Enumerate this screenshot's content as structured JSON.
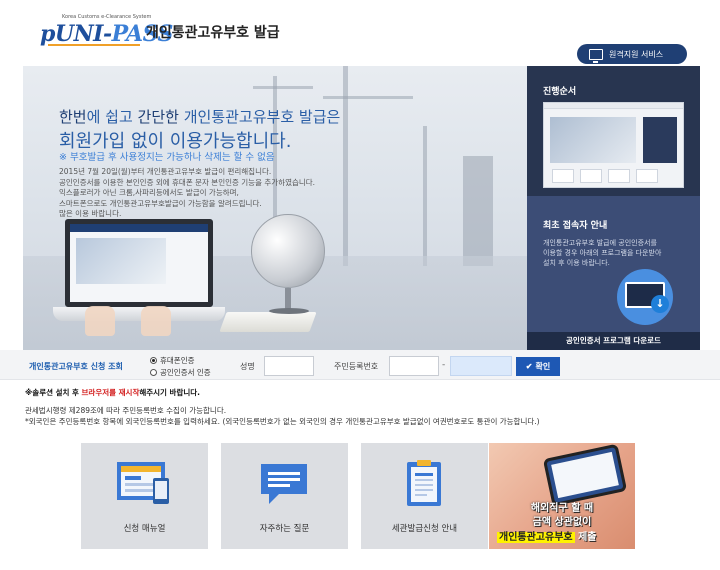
{
  "header": {
    "logo_tagline": "Korea Customs e-Clearance System",
    "logo_text_main": "UNI-",
    "logo_text_accent": "PASS",
    "logo_prefix": "p",
    "site_title": "개인통관고유부호 발급",
    "remote_service_label": "원격지원 서비스"
  },
  "banner": {
    "headline_part1": "한번",
    "headline_part2": "에 쉽고 ",
    "headline_part3": "간단한",
    "headline_part4": " 개인통관고유부호 발급은",
    "headline_line2": "회원가입 없이 이용가능합니다.",
    "note": "※ 부호발급 후 사용정지는 가능하나 삭제는 할 수 없음",
    "description": [
      "2015년 7월 20일(월)부터 개인통관고유부호 발급이 편리해집니다.",
      "공인인증서를 이용한 본인인증 외에 휴대폰 문자 본인인증 기능을 추가하였습니다.",
      "익스플로러가 아닌 크롬,사파리등에서도 발급이 가능하며,",
      "스마트폰으로도 개인통관고유부호발급이 가능함을 알려드립니다.",
      "많은 이용 바랍니다."
    ]
  },
  "right_panel": {
    "process_title": "진행순서",
    "first_visit_title": "최초 접속자 안내",
    "first_visit_desc": [
      "개인통관고유부호 발급에 공인인증서를",
      "이용할 경우 아래의 프로그램을 다운받아",
      "설치 후 이용 바랍니다."
    ],
    "download_label": "공인인증서 프로그램 다운로드"
  },
  "form": {
    "title": "개인통관고유부호 신청 조회",
    "radio_phone": "휴대폰인증",
    "radio_cert": "공인인증서 인증",
    "name_label": "성명",
    "name_value": "",
    "rrn_label": "주민등록번호",
    "rrn_front": "",
    "rrn_back": "",
    "rrn_separator": "-",
    "confirm_label": "확인"
  },
  "notices": {
    "line1_prefix": "※솔루션 설치 후 ",
    "line1_red": "브라우저를 재시작",
    "line1_suffix": "해주시기 바랍니다.",
    "line2": "관세법시행령 제289조에 따라 주민등록번호 수집이 가능합니다.",
    "line3": "*외국인은 주민등록번호 항목에 외국인등록번호를 입력하세요.   (외국인등록번호가 없는 외국인의 경우 개인통관고유부호 발급없이 여권번호로도 통관이 가능합니다.)"
  },
  "tiles": [
    {
      "label": "신청 매뉴얼",
      "icon": "manual-screen-icon"
    },
    {
      "label": "자주하는 질문",
      "icon": "chat-bubble-icon"
    },
    {
      "label": "세관발급신청 안내",
      "icon": "clipboard-document-icon"
    }
  ],
  "promo": {
    "line1": "해외직구 할 때",
    "line2": "금액 상관없이",
    "line3_highlight": "개인통관고유부호",
    "line3_rest": " 제출"
  },
  "colors": {
    "brand_navy": "#1f3f74",
    "brand_blue": "#2a5ea6",
    "accent_red": "#d21a1a",
    "button_blue": "#1e58b4"
  }
}
